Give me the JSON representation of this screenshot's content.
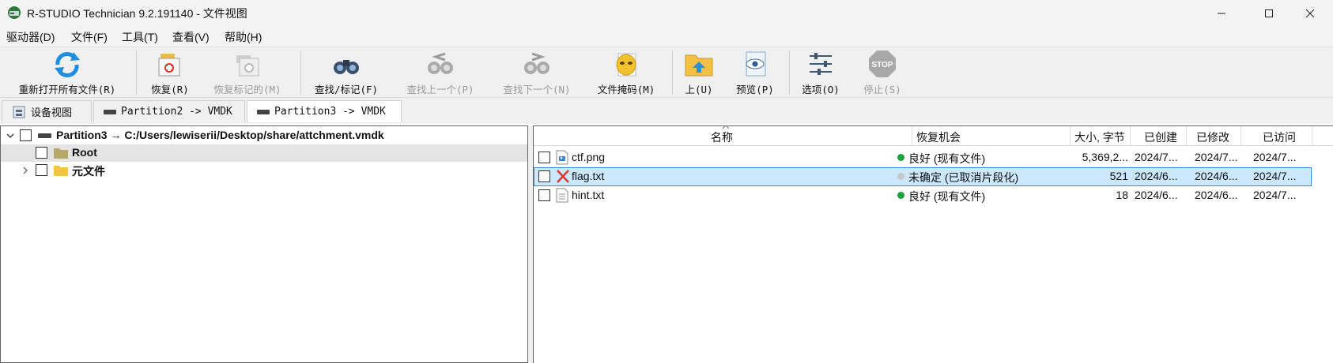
{
  "window": {
    "title": "R-STUDIO Technician 9.2.191140 - 文件视图",
    "minimize_icon": "minimize-icon",
    "maximize_icon": "maximize-icon",
    "close_icon": "close-icon"
  },
  "menu": [
    "驱动器(D)",
    "文件(F)",
    "工具(T)",
    "查看(V)",
    "帮助(H)"
  ],
  "toolbar": {
    "buttons": [
      {
        "label": "重新打开所有文件(R)",
        "icon": "refresh-icon",
        "enabled": true
      },
      {
        "label": "恢复(R)",
        "icon": "recover-icon",
        "enabled": true
      },
      {
        "label": "恢复标记的(M)",
        "icon": "recover-marked-icon",
        "enabled": false
      },
      {
        "label": "查找/标记(F)",
        "icon": "binoculars-icon",
        "enabled": true
      },
      {
        "label": "查找上一个(P)",
        "icon": "find-previous-icon",
        "enabled": false
      },
      {
        "label": "查找下一个(N)",
        "icon": "find-next-icon",
        "enabled": false
      },
      {
        "label": "文件掩码(M)",
        "icon": "file-mask-icon",
        "enabled": true
      },
      {
        "label": "上(U)",
        "icon": "folder-up-icon",
        "enabled": true
      },
      {
        "label": "预览(P)",
        "icon": "preview-icon",
        "enabled": true
      },
      {
        "label": "选项(O)",
        "icon": "options-icon",
        "enabled": true
      },
      {
        "label": "停止(S)",
        "icon": "stop-icon",
        "enabled": false
      }
    ],
    "stop_text": "STOP"
  },
  "tabs": [
    {
      "label": "设备视图",
      "icon": "device-view-icon",
      "active": false
    },
    {
      "label": "Partition2 -> VMDK",
      "icon": "disk-icon",
      "active": false
    },
    {
      "label": "Partition3 -> VMDK",
      "icon": "disk-icon",
      "active": true
    }
  ],
  "tree": {
    "root": {
      "label": "Partition3 → C:/Users/lewiserii/Desktop/share/attchment.vmdk"
    },
    "children": [
      {
        "label": "Root",
        "selected": true
      },
      {
        "label": "元文件",
        "selected": false
      }
    ]
  },
  "grid": {
    "columns": [
      "名称",
      "恢复机会",
      "大小, 字节",
      "已创建",
      "已修改",
      "已访问"
    ],
    "rows": [
      {
        "name": "ctf.png",
        "icon": "image-file-icon",
        "chance": "良好 (现有文件)",
        "chance_color": "#1aa33c",
        "size": "5,369,2...",
        "created": "2024/7...",
        "modified": "2024/7...",
        "accessed": "2024/7...",
        "selected": false
      },
      {
        "name": "flag.txt",
        "icon": "deleted-file-icon",
        "chance": "未确定 (已取消片段化)",
        "chance_color": "#c8c8c8",
        "size": "521",
        "created": "2024/6...",
        "modified": "2024/6...",
        "accessed": "2024/7...",
        "selected": true
      },
      {
        "name": "hint.txt",
        "icon": "text-file-icon",
        "chance": "良好 (现有文件)",
        "chance_color": "#1aa33c",
        "size": "18",
        "created": "2024/6...",
        "modified": "2024/6...",
        "accessed": "2024/7...",
        "selected": false
      }
    ]
  }
}
